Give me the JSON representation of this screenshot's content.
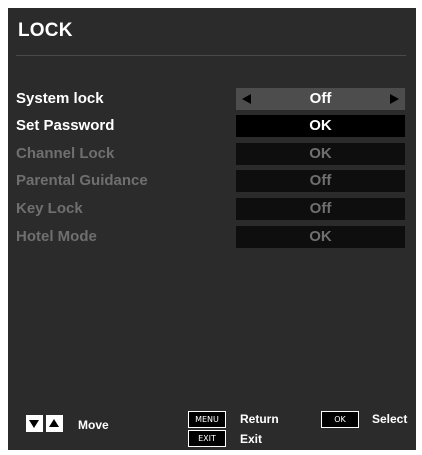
{
  "header": {
    "title": "LOCK"
  },
  "menu": {
    "items": [
      {
        "label": "System lock",
        "value": "Off",
        "enabled": true,
        "selected": true
      },
      {
        "label": "Set Password",
        "value": "OK",
        "enabled": true,
        "selected": false
      },
      {
        "label": "Channel Lock",
        "value": "OK",
        "enabled": false,
        "selected": false
      },
      {
        "label": "Parental Guidance",
        "value": "Off",
        "enabled": false,
        "selected": false
      },
      {
        "label": "Key Lock",
        "value": "Off",
        "enabled": false,
        "selected": false
      },
      {
        "label": "Hotel Mode",
        "value": "OK",
        "enabled": false,
        "selected": false
      }
    ]
  },
  "footer": {
    "move_label": "Move",
    "menu_key": "MENU",
    "return_label": "Return",
    "exit_key": "EXIT",
    "exit_label": "Exit",
    "ok_key": "OK",
    "select_label": "Select"
  },
  "colors": {
    "background": "#2b2b2b",
    "selected_value_bg": "#4d4d4d",
    "value_bg": "#000000",
    "disabled_text": "#6f6f6f",
    "text": "#ffffff"
  },
  "icons": {
    "value_prev": "arrow-left-icon",
    "value_next": "arrow-right-icon",
    "nav_down": "arrow-down-icon",
    "nav_up": "arrow-up-icon"
  }
}
